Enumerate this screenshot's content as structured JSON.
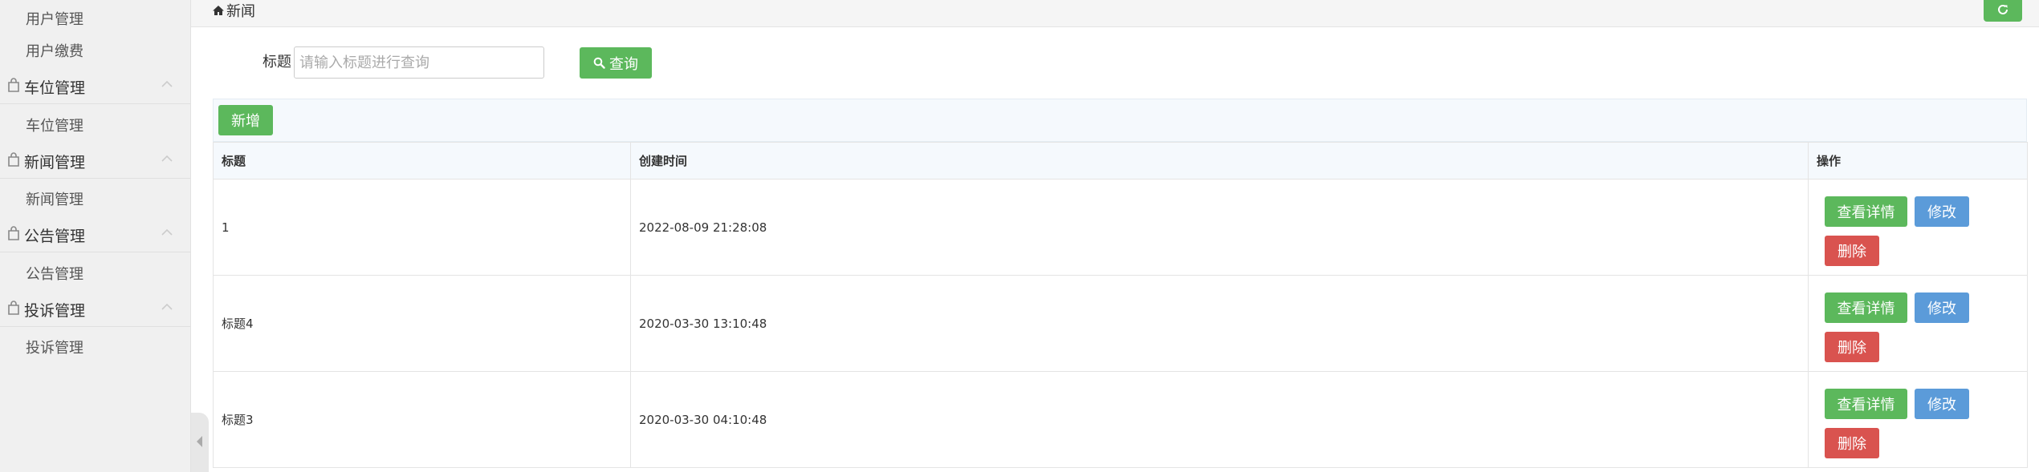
{
  "sidebar": {
    "children_top": [
      "用户管理",
      "用户缴费"
    ],
    "groups": [
      {
        "label": "车位管理",
        "child": "车位管理"
      },
      {
        "label": "新闻管理",
        "child": "新闻管理"
      },
      {
        "label": "公告管理",
        "child": "公告管理"
      },
      {
        "label": "投诉管理",
        "child": "投诉管理"
      }
    ]
  },
  "header": {
    "breadcrumb": "新闻"
  },
  "search": {
    "label": "标题",
    "placeholder": "请输入标题进行查询",
    "button": "查询"
  },
  "toolbar": {
    "add_label": "新增"
  },
  "table": {
    "columns": [
      "标题",
      "创建时间",
      "操作"
    ],
    "rows": [
      {
        "title": "1",
        "created": "2022-08-09 21:28:08"
      },
      {
        "title": "标题4",
        "created": "2020-03-30 13:10:48"
      },
      {
        "title": "标题3",
        "created": "2020-03-30 04:10:48"
      }
    ],
    "actions": {
      "detail": "查看详情",
      "edit": "修改",
      "delete": "删除"
    }
  },
  "colors": {
    "green": "#5cb85c",
    "blue": "#5b9bd9",
    "red": "#d9534f"
  }
}
